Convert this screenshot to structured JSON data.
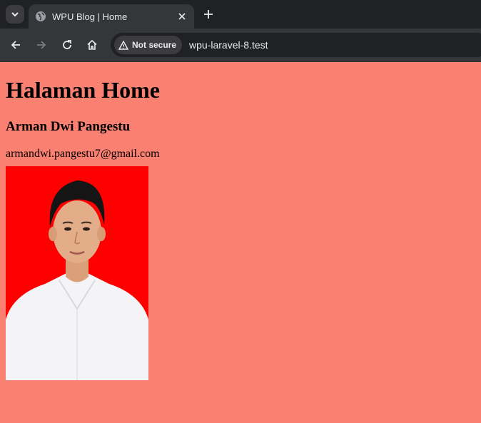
{
  "browser": {
    "tab_title": "WPU Blog | Home",
    "security_label": "Not secure",
    "url": "wpu-laravel-8.test"
  },
  "page": {
    "heading": "Halaman Home",
    "name": "Arman Dwi Pangestu",
    "email": "armandwi.pangestu7@gmail.com",
    "photo": {
      "background_color": "#ff0000",
      "subject": "portrait-photo",
      "shirt_color": "#f4f4f6"
    },
    "background_color": "#fa8072"
  }
}
